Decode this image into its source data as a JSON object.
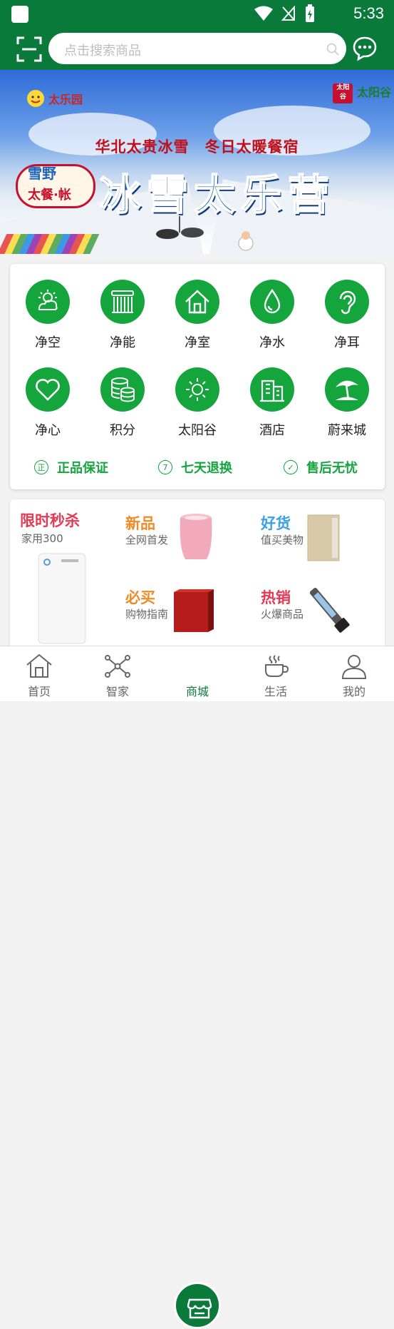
{
  "status_bar": {
    "time": "5:33"
  },
  "header": {
    "scan_icon": "scan-icon",
    "search_placeholder": "点击搜索商品",
    "message_icon": "chat-icon",
    "accent": "#0a7a3a"
  },
  "banner": {
    "logo_left": "太乐园",
    "logo_right": "太阳谷",
    "tagline": "华北太贵冰雪　冬日太暖餐宿",
    "title": "冰雪太乐营",
    "badge_line1": "雪野",
    "badge_line2": "太餐·帐"
  },
  "categories": [
    {
      "label": "净空",
      "icon": "sun-cloud-icon"
    },
    {
      "label": "净能",
      "icon": "solar-heater-icon"
    },
    {
      "label": "净室",
      "icon": "house-icon"
    },
    {
      "label": "净水",
      "icon": "water-drop-icon"
    },
    {
      "label": "净耳",
      "icon": "ear-icon"
    },
    {
      "label": "净心",
      "icon": "heart-icon"
    },
    {
      "label": "积分",
      "icon": "coins-icon"
    },
    {
      "label": "太阳谷",
      "icon": "sun-icon"
    },
    {
      "label": "酒店",
      "icon": "building-icon"
    },
    {
      "label": "蔚来城",
      "icon": "beach-umbrella-icon"
    }
  ],
  "guarantees": [
    {
      "label": "正品保证",
      "mark": "正"
    },
    {
      "label": "七天退换",
      "mark": "7"
    },
    {
      "label": "售后无忧",
      "mark": "✓"
    }
  ],
  "promos": {
    "flash": {
      "title": "限时秒杀",
      "sub": "家用300"
    },
    "new": {
      "title": "新品",
      "sub": "全网首发"
    },
    "good": {
      "title": "好货",
      "sub": "值买美物"
    },
    "must": {
      "title": "必买",
      "sub": "购物指南"
    },
    "hot": {
      "title": "热销",
      "sub": "火爆商品"
    }
  },
  "tabs": [
    {
      "label": "首页",
      "icon": "home-icon"
    },
    {
      "label": "智家",
      "icon": "network-icon"
    },
    {
      "label": "商城",
      "icon": "store-icon"
    },
    {
      "label": "生活",
      "icon": "coffee-icon"
    },
    {
      "label": "我的",
      "icon": "person-icon"
    }
  ]
}
